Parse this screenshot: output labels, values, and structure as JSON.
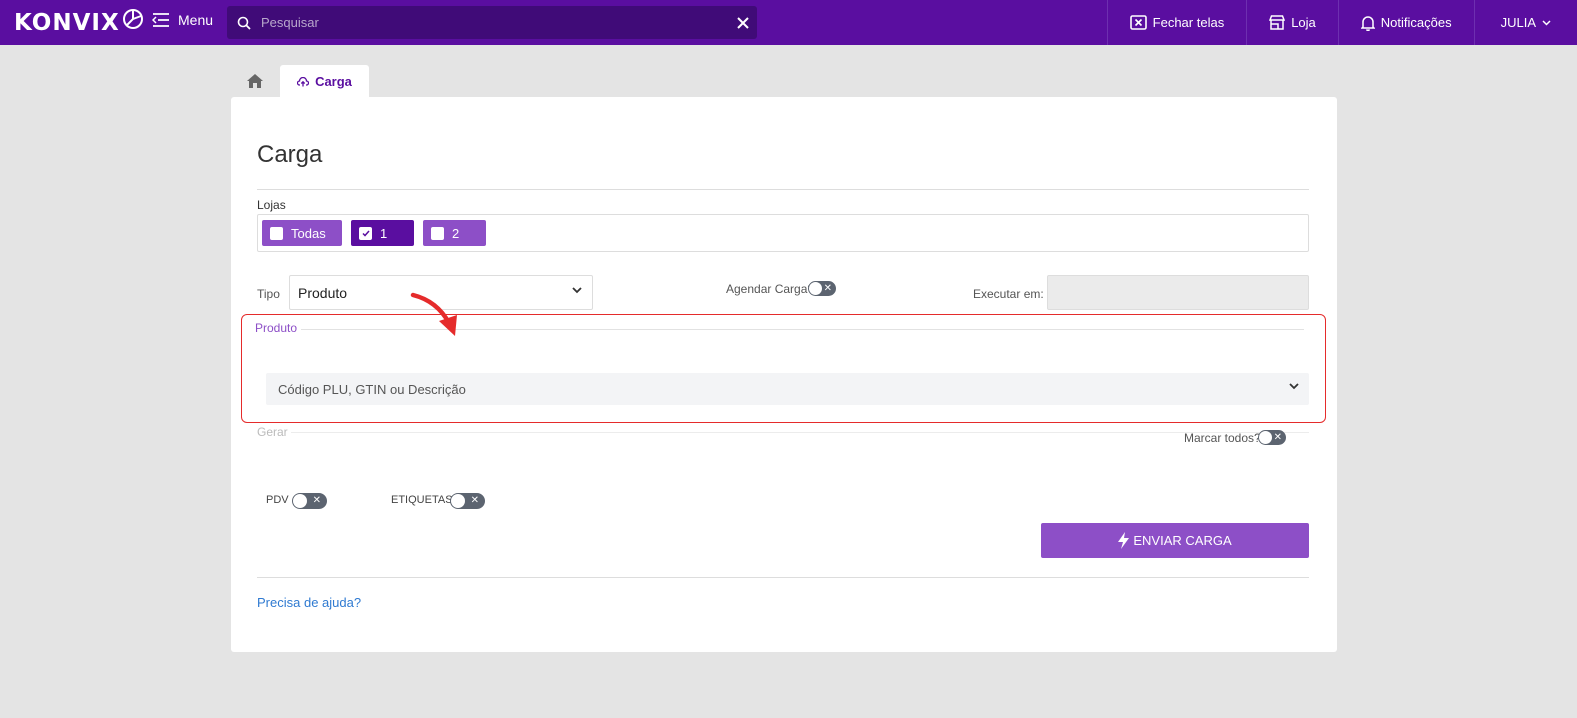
{
  "topbar": {
    "logo_text": "KONVIX",
    "menu_label": "Menu",
    "search_placeholder": "Pesquisar",
    "fechar_telas": "Fechar telas",
    "loja": "Loja",
    "notificacoes": "Notificações",
    "user": "JULIA"
  },
  "tabs": {
    "active_label": "Carga"
  },
  "page": {
    "title": "Carga",
    "lojas_label": "Lojas",
    "lojas": [
      {
        "label": "Todas",
        "checked": false
      },
      {
        "label": "1",
        "checked": true
      },
      {
        "label": "2",
        "checked": false
      }
    ],
    "tipo_label": "Tipo",
    "tipo_value": "Produto",
    "agendar_label": "Agendar Carga?",
    "executar_label": "Executar em:",
    "produto_legend": "Produto",
    "produto_placeholder": "Código PLU, GTIN ou Descrição",
    "gerar_legend": "Gerar",
    "marcar_todos_label": "Marcar todos?",
    "pdv_label": "PDV",
    "etiquetas_label": "ETIQUETAS",
    "enviar_label": "ENVIAR CARGA",
    "help_link": "Precisa de ajuda?"
  },
  "colors": {
    "brand": "#5a0ea0",
    "accent": "#8d4fc7",
    "highlight": "#e52b2b",
    "link": "#2f7ad1"
  }
}
